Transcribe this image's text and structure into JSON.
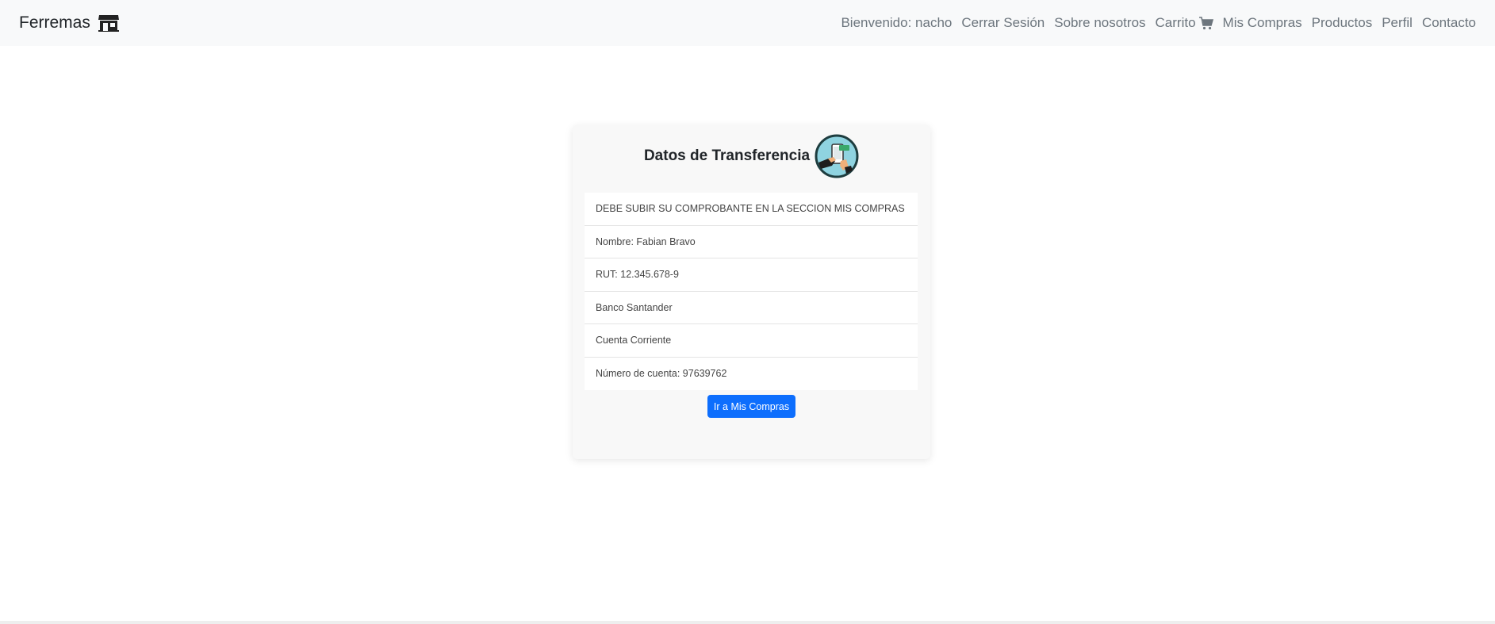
{
  "navbar": {
    "brand": "Ferremas",
    "items": [
      {
        "label": "Bienvenido: nacho"
      },
      {
        "label": "Cerrar Sesión"
      },
      {
        "label": "Sobre nosotros"
      },
      {
        "label": "Carrito"
      },
      {
        "label": "Mis Compras"
      },
      {
        "label": "Productos"
      },
      {
        "label": "Perfil"
      },
      {
        "label": "Contacto"
      }
    ],
    "icons": {
      "brand": "store-icon",
      "cart": "cart-icon"
    }
  },
  "card": {
    "title": "Datos de Transferencia",
    "icon": "transfer-payment-icon",
    "items": [
      "DEBE SUBIR SU COMPROBANTE EN LA SECCION MIS COMPRAS",
      "Nombre: Fabian Bravo",
      "RUT: 12.345.678-9",
      "Banco Santander",
      "Cuenta Corriente",
      "Número de cuenta: 97639762"
    ],
    "button_label": "Ir a Mis Compras",
    "button_color": "#0d6efd"
  }
}
